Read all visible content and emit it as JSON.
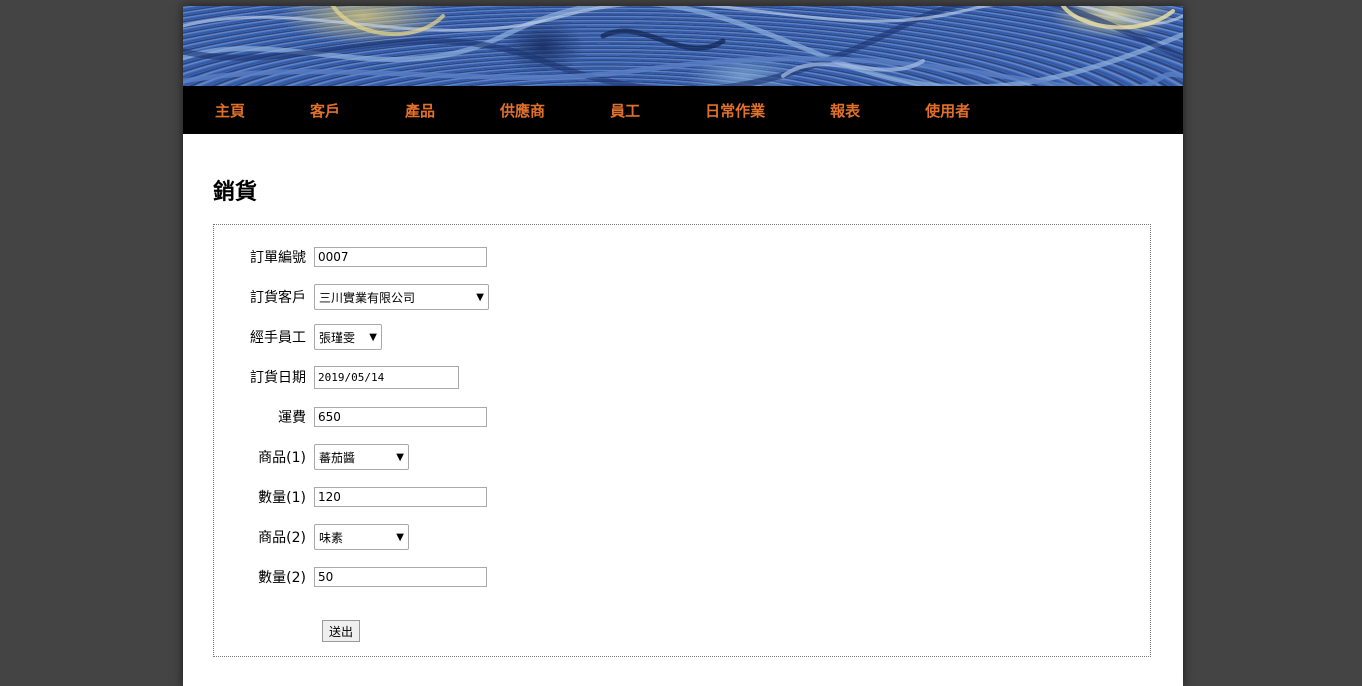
{
  "nav": {
    "items": [
      "主頁",
      "客戶",
      "產品",
      "供應商",
      "員工",
      "日常作業",
      "報表",
      "使用者"
    ]
  },
  "page_title": "銷貨",
  "form": {
    "order_no": {
      "label": "訂單編號",
      "value": "0007"
    },
    "customer": {
      "label": "訂貨客戶",
      "value": "三川實業有限公司"
    },
    "employee": {
      "label": "經手員工",
      "value": "張瑾雯"
    },
    "order_date": {
      "label": "訂貨日期",
      "value": "2019/05/14"
    },
    "freight": {
      "label": "運費",
      "value": "650"
    },
    "product1": {
      "label": "商品(1)",
      "value": "蕃茄醬"
    },
    "qty1": {
      "label": "數量(1)",
      "value": "120"
    },
    "product2": {
      "label": "商品(2)",
      "value": "味素"
    },
    "qty2": {
      "label": "數量(2)",
      "value": "50"
    },
    "submit_label": "送出"
  },
  "colors": {
    "background": "#444444",
    "nav_bg": "#000000",
    "nav_text": "#e0702a"
  }
}
